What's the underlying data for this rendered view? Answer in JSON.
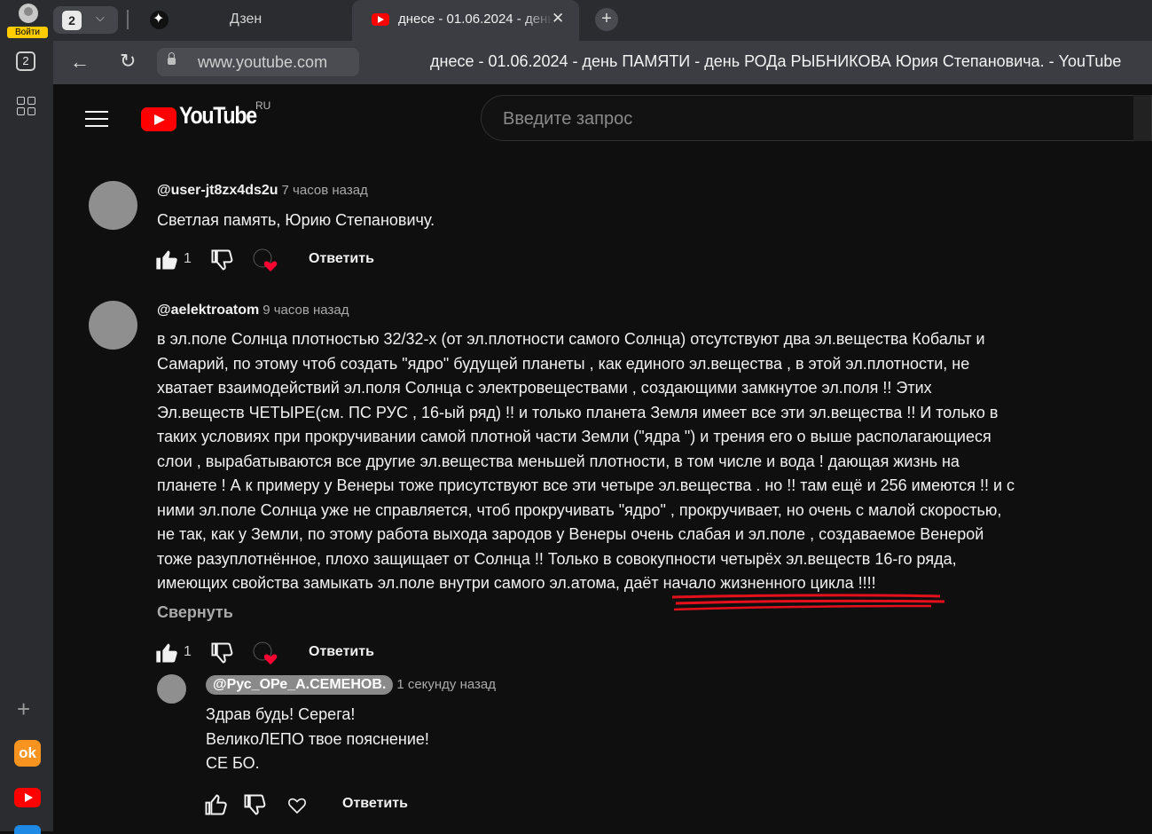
{
  "browser": {
    "login_label": "Войти",
    "tabs_count": "2",
    "tabs": [
      {
        "label": "Дзен"
      },
      {
        "label": "днесе - 01.06.2024 - день ПАМЯТИ"
      }
    ],
    "address": "www.youtube.com",
    "page_title": "днесе - 01.06.2024 - день ПАМЯТИ - день РОДа РЫБНИКОВА Юрия Степановича. - YouTube"
  },
  "youtube": {
    "logo_text": "YouTube",
    "region": "RU",
    "search_placeholder": "Введите запрос"
  },
  "comments": [
    {
      "author": "@user-jt8zx4ds2u",
      "time": "7 часов назад",
      "text": "Светлая память, Юрию Степановичу.",
      "likes": "1",
      "reply_label": "Ответить"
    },
    {
      "author": "@aelektroatom",
      "time": "9 часов назад",
      "lines": [
        "в эл.поле Солнца плотностью 32/32-х (от эл.плотности самого Солнца) отсутствуют два эл.вещества Кобальт и",
        "Самарий, по этому чтоб создать \"ядро\" будущей планеты , как единого эл.вещества , в этой эл.плотности,  не",
        "хватает взаимодействий эл.поля Солнца с электровеществами , создающими замкнутое эл.поля !! Этих",
        "Эл.веществ ЧЕТЫРЕ(см. ПС РУС , 16-ый ряд) !! и только планета Земля имеет все эти эл.вещества !! И только в",
        "таких условиях при прокручивании самой плотной части Земли (\"ядра \") и трения его о выше располагающиеся",
        "слои , вырабатываются все другие эл.вещества меньшей плотности, в том числе и вода ! дающая жизнь на",
        "планете ! А к примеру у Венеры тоже присутствуют все эти четыре эл.вещества . но !! там ещё и 256 имеются !! и с",
        "ними эл.поле Солнца уже не справляется, чтоб прокручивать \"ядро\" , прокручивает, но очень с малой скоростью,",
        "не так, как у Земли, по этому работа выхода зародов у Венеры очень слабая и эл.поле , создаваемое Венерой",
        "тоже разуплотнённое, плохо защищает от Солнца !! Только в совокупности четырёх эл.веществ 16-го ряда,",
        "имеющих свойства замыкать эл.поле внутри самого эл.атома, даёт начало жизненного цикла !!!!"
      ],
      "collapse_label": "Свернуть",
      "likes": "1",
      "reply_label": "Ответить"
    },
    {
      "author": "@Рус_ОРе_А.СЕМЕНОВ.",
      "time": "1 секунду назад",
      "lines": [
        "Здрав будь! Серега!",
        "ВеликоЛЕПО твое пояснение!",
        "СЕ БО."
      ],
      "reply_label": "Ответить"
    }
  ]
}
